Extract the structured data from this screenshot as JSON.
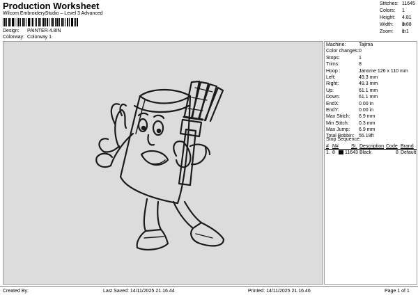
{
  "header": {
    "title": "Production Worksheet",
    "subtitle": "Wilcom EmbroideryStudio – Level 3 Advanced"
  },
  "meta": {
    "design_label": "Design:",
    "design_value": "PAINTER 4.8IN",
    "colorway_label": "Colorway:",
    "colorway_value": "Colorway 1"
  },
  "info": {
    "stitches_label": "Stitches:",
    "stitches": "11645",
    "colors_label": "Colors:",
    "colors": "1",
    "height_label": "Height:",
    "height": "4.81 in",
    "width_label": "Width:",
    "width": "3.88 in",
    "zoom_label": "Zoom:",
    "zoom": "1:1"
  },
  "machine_info": [
    {
      "label": "Machine:",
      "value": "Tajima"
    },
    {
      "label": "Color changes:",
      "value": "0"
    },
    {
      "label": "Stops:",
      "value": "1"
    },
    {
      "label": "Trims:",
      "value": "8"
    },
    {
      "label": "Hoop :",
      "value": "Janome 126 x 110 mm"
    },
    {
      "label": "Left:",
      "value": "49.3 mm"
    },
    {
      "label": "Right:",
      "value": "49.3 mm"
    },
    {
      "label": "Up:",
      "value": "61.1 mm"
    },
    {
      "label": "Down:",
      "value": "61.1 mm"
    },
    {
      "label": "EndX:",
      "value": "0.00 in"
    },
    {
      "label": "EndY:",
      "value": "0.00 in"
    },
    {
      "label": "Max Stitch:",
      "value": "6.9 mm"
    },
    {
      "label": "Min Stitch:",
      "value": "0.3 mm"
    },
    {
      "label": "Max Jump:",
      "value": "6.9 mm"
    },
    {
      "label": "Total Bobbin:",
      "value": "55.19ft"
    }
  ],
  "stop_sequence": {
    "title": "Stop Sequence:",
    "headers": {
      "num": "#",
      "n": "N#",
      "st": "St.",
      "desc": "Description",
      "code": "Code",
      "brand": "Brand"
    },
    "rows": [
      {
        "num": "1.",
        "n": "8",
        "st": "11643",
        "desc": "Black",
        "code": "8",
        "brand": "Default",
        "color": "#000000"
      }
    ]
  },
  "footer": {
    "created_by": "Created By:",
    "last_saved": "Last Saved: 14/11/2025 21.16.44",
    "printed": "Printed: 14/11/2025 21.16.46",
    "page": "Page 1 of 1"
  }
}
